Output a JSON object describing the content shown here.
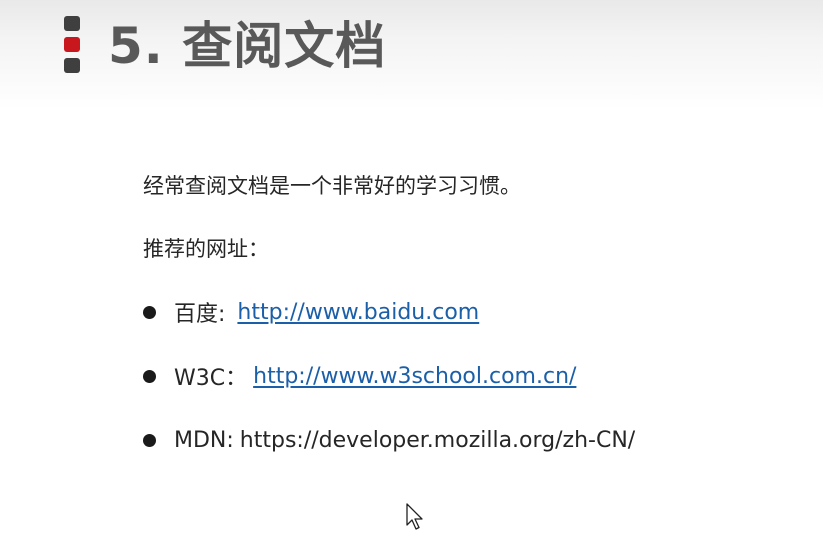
{
  "slide": {
    "title": "5. 查阅文档",
    "intro": "经常查阅文档是一个非常好的学习习惯。",
    "sites_label": "推荐的网址：",
    "sites": [
      {
        "label": "百度:",
        "url": "http://www.baidu.com",
        "is_link": true
      },
      {
        "label": "W3C：",
        "url": "http://www.w3school.com.cn/",
        "is_link": true
      },
      {
        "label": "MDN:",
        "url": "https://developer.mozilla.org/zh-CN/",
        "is_link": false
      }
    ]
  },
  "colors": {
    "title_text": "#595959",
    "marker_red": "#c8171d",
    "marker_dark": "#3f3f3f",
    "link": "#1b5fa8",
    "body_text": "#262626"
  },
  "icons": {
    "title_marker": "slide-marker-icon",
    "bullet": "bullet-icon",
    "cursor": "mouse-cursor-icon"
  }
}
